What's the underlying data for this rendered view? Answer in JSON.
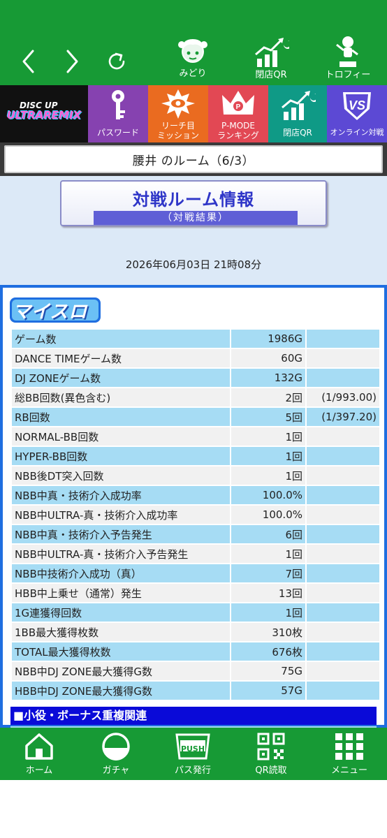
{
  "topnav": {
    "midori_label": "みどり",
    "closing_qr_label": "閉店QR",
    "trophy_label": "トロフィー"
  },
  "menu": {
    "logo_line1": "DISC UP",
    "logo_line2": "ULTRAREMIX",
    "password_label": "パスワード",
    "mission_label_1": "リーチ目",
    "mission_label_2": "ミッション",
    "pmode_label_1": "P-MODE",
    "pmode_label_2": "ランキング",
    "closing_qr_label": "閉店QR",
    "online_label": "オンライン対戦"
  },
  "room": {
    "title": "腰井 のルーム（6/3）"
  },
  "banner": {
    "title": "対戦ルーム情報",
    "subtitle": "（対戦結果）"
  },
  "datetime": "2026年06月03日 21時08分",
  "panel": {
    "logo_text": "マイスロ"
  },
  "stats": [
    {
      "label": "ゲーム数",
      "value": "1986G",
      "ratio": ""
    },
    {
      "label": "DANCE TIMEゲーム数",
      "value": "60G",
      "ratio": ""
    },
    {
      "label": "DJ ZONEゲーム数",
      "value": "132G",
      "ratio": ""
    },
    {
      "label": "総BB回数(異色含む)",
      "value": "2回",
      "ratio": "(1/993.00)"
    },
    {
      "label": "RB回数",
      "value": "5回",
      "ratio": "(1/397.20)"
    },
    {
      "label": "NORMAL-BB回数",
      "value": "1回",
      "ratio": ""
    },
    {
      "label": "HYPER-BB回数",
      "value": "1回",
      "ratio": ""
    },
    {
      "label": "NBB後DT突入回数",
      "value": "1回",
      "ratio": ""
    },
    {
      "label": "NBB中真・技術介入成功率",
      "value": "100.0%",
      "ratio": ""
    },
    {
      "label": "NBB中ULTRA-真・技術介入成功率",
      "value": "100.0%",
      "ratio": ""
    },
    {
      "label": "NBB中真・技術介入予告発生",
      "value": "6回",
      "ratio": ""
    },
    {
      "label": "NBB中ULTRA-真・技術介入予告発生",
      "value": "1回",
      "ratio": ""
    },
    {
      "label": "NBB中技術介入成功（真）",
      "value": "7回",
      "ratio": ""
    },
    {
      "label": "HBB中上乗せ（通常）発生",
      "value": "13回",
      "ratio": ""
    },
    {
      "label": "1G連獲得回数",
      "value": "1回",
      "ratio": ""
    },
    {
      "label": "1BB最大獲得枚数",
      "value": "310枚",
      "ratio": ""
    },
    {
      "label": "TOTAL最大獲得枚数",
      "value": "676枚",
      "ratio": ""
    },
    {
      "label": "NBB中DJ ZONE最大獲得G数",
      "value": "75G",
      "ratio": ""
    },
    {
      "label": "HBB中DJ ZONE最大獲得G数",
      "value": "57G",
      "ratio": ""
    }
  ],
  "section_heading": "■小役・ボーナス重複関連",
  "bottomnav": {
    "home_label": "ホーム",
    "gacha_label": "ガチャ",
    "push_text": "PUSH",
    "pass_label": "パス発行",
    "qr_read_label": "QR読取",
    "menu_label": "メニュー"
  },
  "colors": {
    "brand_green": "#179a35",
    "row_blue": "#a6dcf4",
    "panel_border": "#1f6ee0",
    "section_blue": "#0a0ad8"
  }
}
